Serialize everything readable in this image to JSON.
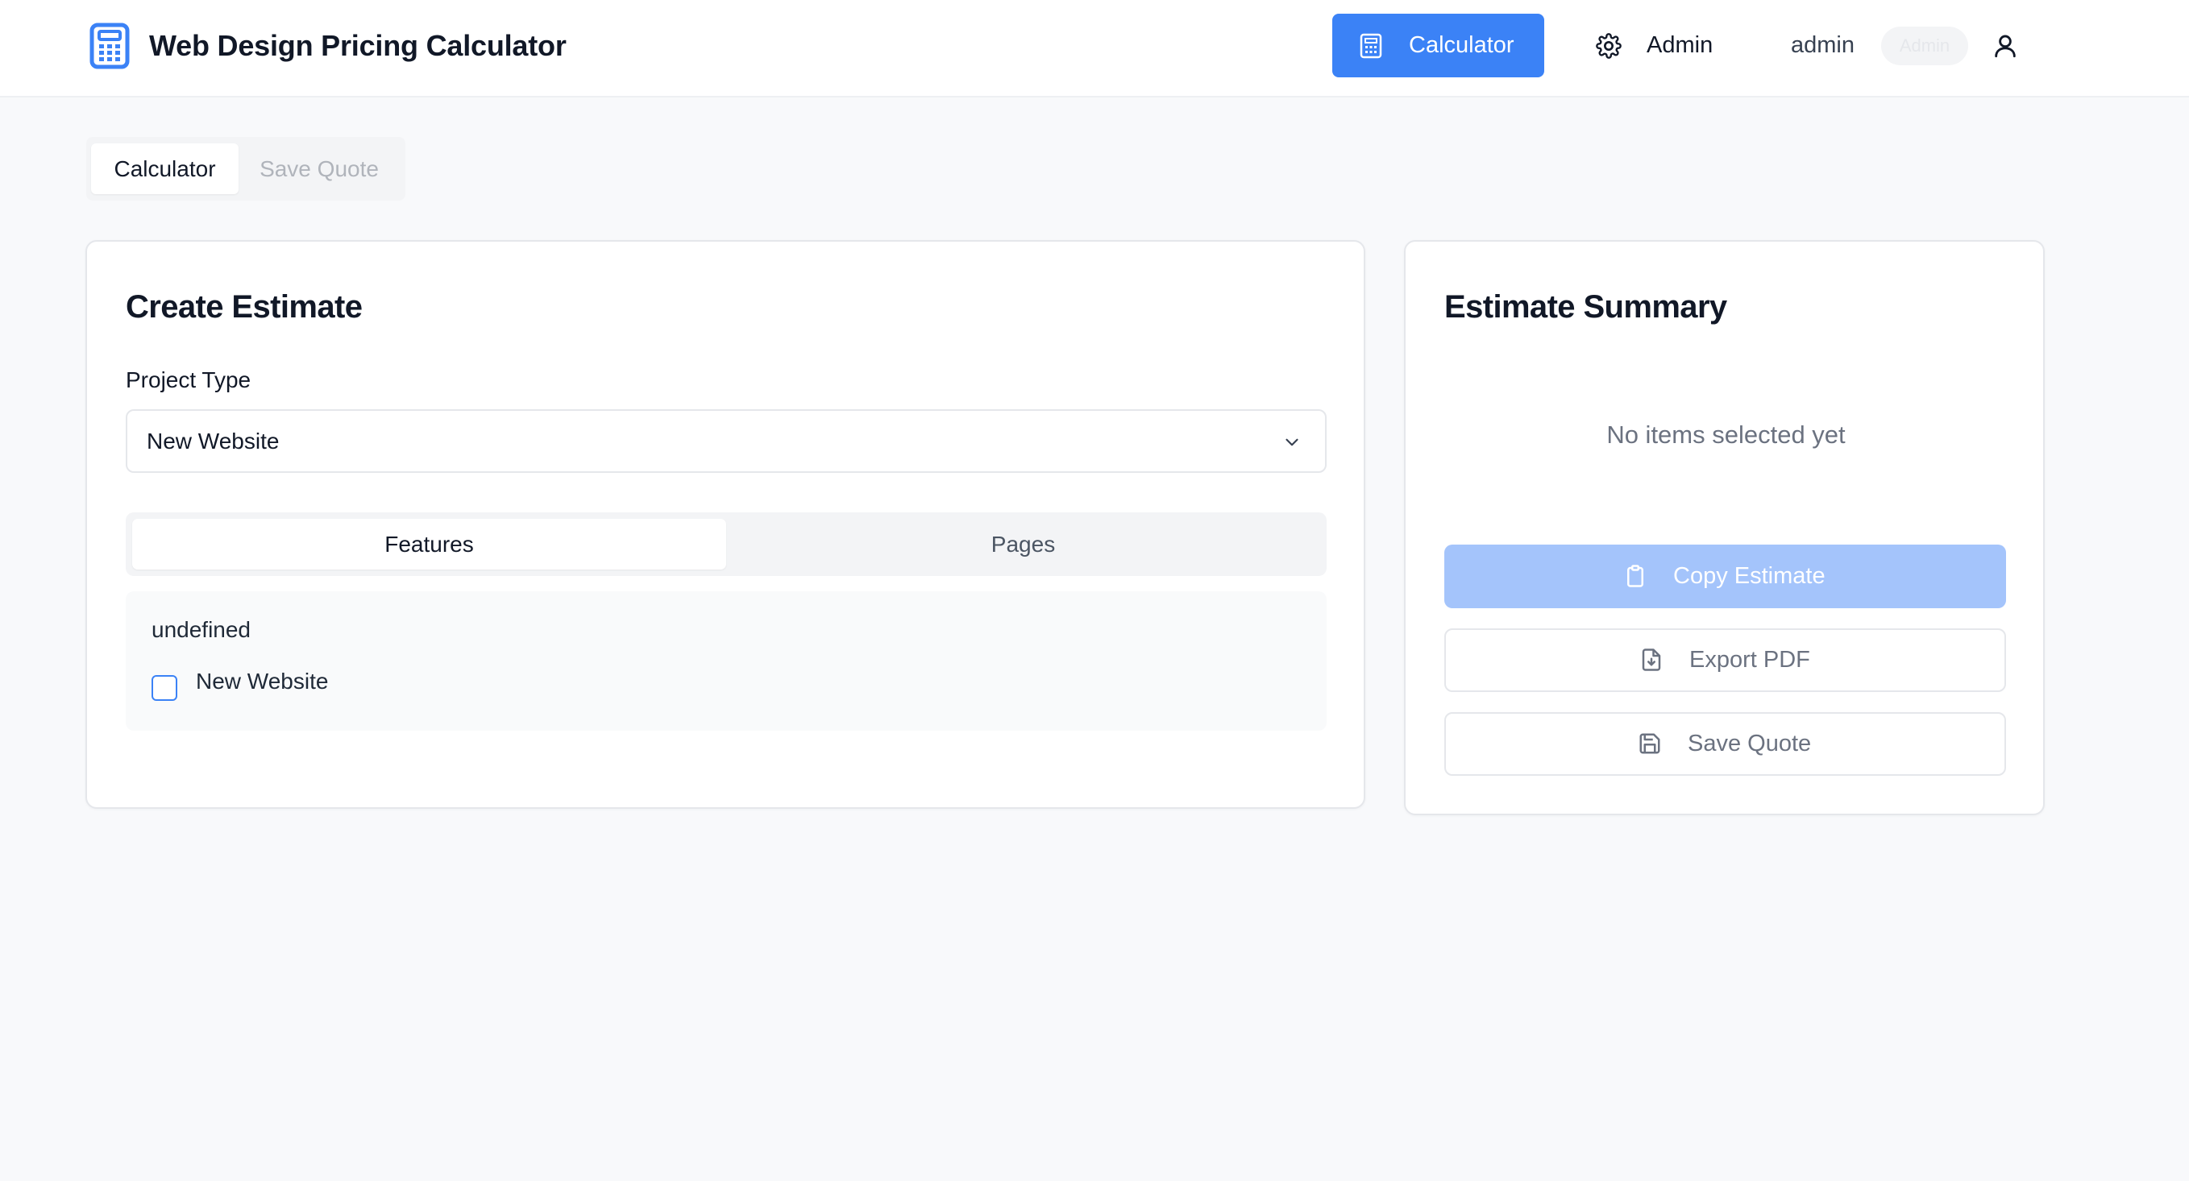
{
  "header": {
    "app_title": "Web Design Pricing Calculator",
    "nav": {
      "calculator_label": "Calculator",
      "admin_label": "Admin"
    },
    "user": {
      "name": "admin",
      "role_badge": "Admin"
    },
    "icons": {
      "logo": "calculator-icon",
      "nav_calculator": "calculator-icon",
      "nav_admin": "gear-icon",
      "user": "user-icon"
    }
  },
  "top_tabs": [
    {
      "label": "Calculator",
      "active": true
    },
    {
      "label": "Save Quote",
      "active": false
    }
  ],
  "create_estimate": {
    "title": "Create Estimate",
    "project_type": {
      "label": "Project Type",
      "selected": "New Website"
    },
    "tabs": [
      {
        "label": "Features",
        "active": true
      },
      {
        "label": "Pages",
        "active": false
      }
    ],
    "feature_group": {
      "heading": "undefined",
      "items": [
        {
          "label": "New Website",
          "checked": false
        }
      ]
    }
  },
  "estimate_summary": {
    "title": "Estimate Summary",
    "empty_message": "No items selected yet",
    "actions": {
      "copy_label": "Copy Estimate",
      "export_label": "Export PDF",
      "save_label": "Save Quote"
    }
  },
  "colors": {
    "primary": "#3b82f6",
    "primary_disabled": "#a4c4fb",
    "background": "#f8f9fb"
  }
}
